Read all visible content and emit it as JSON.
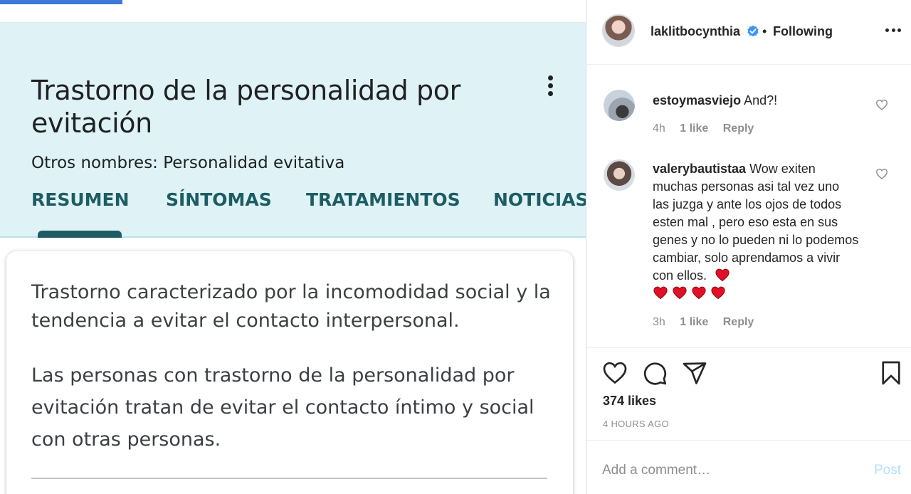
{
  "post_image": {
    "card_title": "Trastorno de la personalidad por evitación",
    "other_names": "Otros nombres: Personalidad evitativa",
    "tabs": [
      "RESUMEN",
      "SÍNTOMAS",
      "TRATAMIENTOS",
      "NOTICIAS"
    ],
    "active_tab": "RESUMEN",
    "description": [
      "Trastorno caracterizado por la incomodidad social y la tendencia a evitar el contacto interpersonal.",
      "Las personas con trastorno de la personalidad por evitación tratan de evitar el contacto íntimo y social con otras personas."
    ]
  },
  "header": {
    "username": "laklitbocynthia",
    "verified_icon": "verified-badge-icon",
    "separator": "•",
    "follow_status": "Following",
    "more_icon": "more-options-icon"
  },
  "comments": [
    {
      "username": "estoymasviejo",
      "text": "And?!",
      "time": "4h",
      "likes": "1 like",
      "reply": "Reply"
    },
    {
      "username": "valerybautistaa",
      "text": "Wow exiten muchas personas asi tal vez uno las juzga y ante los ojos de todos esten mal , pero eso esta en sus genes y no lo pueden ni lo podemos cambiar, solo aprendamos a vivir con ellos.",
      "time": "3h",
      "likes": "1 like",
      "reply": "Reply"
    }
  ],
  "actions": {
    "icons": [
      "heart-icon",
      "comment-icon",
      "share-icon",
      "bookmark-icon"
    ],
    "likes": "374 likes",
    "time_ago": "4 HOURS AGO"
  },
  "comment_box": {
    "placeholder": "Add a comment…",
    "post_label": "Post"
  },
  "colors": {
    "header_bg": "#dff3f6",
    "tab_text": "#1e5c63",
    "verified": "#3897f0",
    "emoji_heart": "#e0102a",
    "post_button": "#b2dffc"
  }
}
